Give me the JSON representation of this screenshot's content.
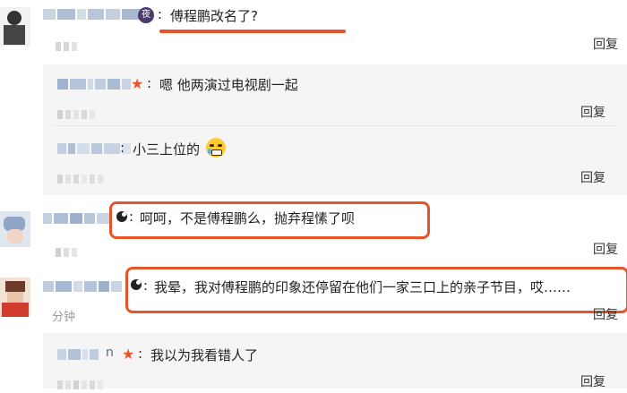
{
  "colors": {
    "accent": "#e8542a",
    "badge": "#4a3d6b"
  },
  "reply_label": "回复",
  "comments": [
    {
      "badge": "夜",
      "text": "傅程鹏改名了?",
      "time": ""
    },
    {
      "text": "嗯  他两演过电视剧一起",
      "star": "★"
    },
    {
      "text": "小三上位的"
    },
    {
      "text": "呵呵，不是傅程鹏么，抛弃程愫了呗"
    },
    {
      "text": "我晕，我对傅程鹏的印象还停留在他们一家三口上的亲子节目，哎……",
      "time": "分钟"
    },
    {
      "name_fragment": "n",
      "star": "★",
      "text": "我以为我看错人了"
    }
  ]
}
